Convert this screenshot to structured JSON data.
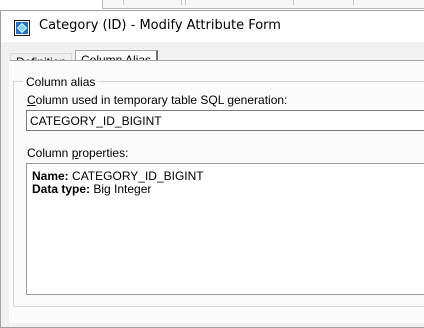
{
  "window": {
    "title": "Category (ID) - Modify Attribute Form"
  },
  "tabs": [
    {
      "label": "Definition",
      "active": false
    },
    {
      "label": "Column Alias",
      "active": true
    }
  ],
  "column_alias": {
    "group_label": "Column alias",
    "sql_label_prefix": "C",
    "sql_label_rest": "olumn used in temporary table SQL generation:",
    "sql_value": "CATEGORY_ID_BIGINT",
    "props_label_prefix": "Column ",
    "props_label_u": "p",
    "props_label_rest": "roperties:",
    "properties": [
      {
        "key": "Name:",
        "value": "CATEGORY_ID_BIGINT"
      },
      {
        "key": "Data type:",
        "value": "Big Integer"
      }
    ]
  }
}
